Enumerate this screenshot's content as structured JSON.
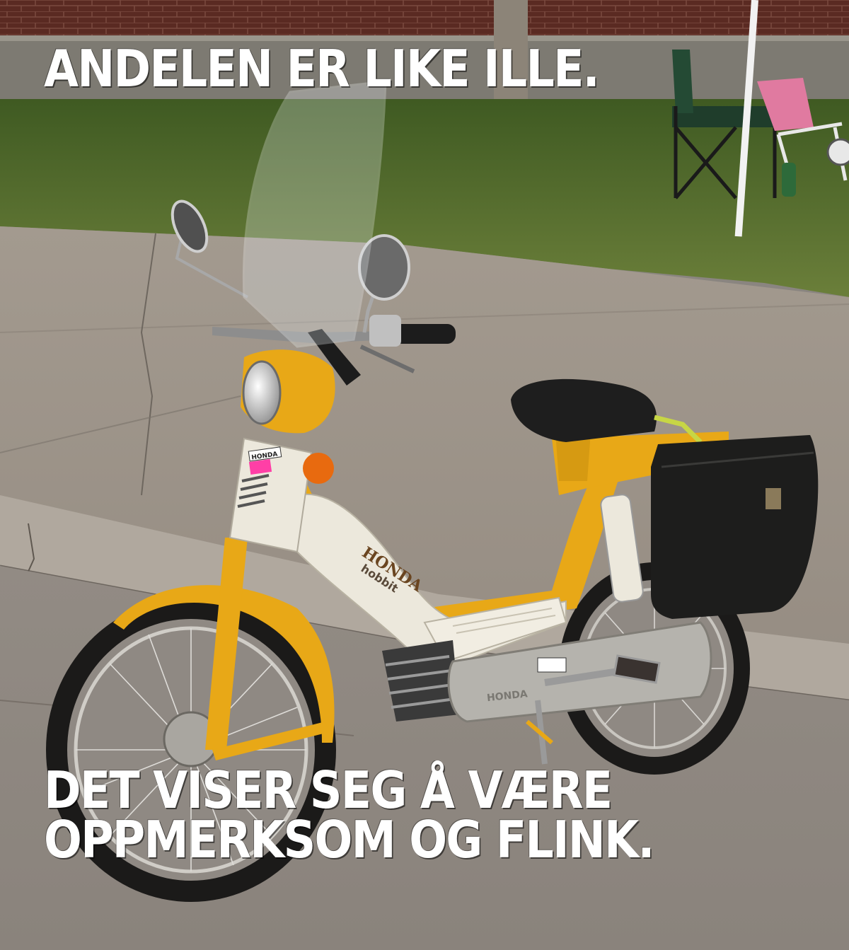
{
  "meme": {
    "top_text": "ANDELEN ER LIKE ILLE.",
    "bottom_lines": [
      "DET VISER SEG Å VÆRE",
      "OPPMERKSOM OG FLINK."
    ]
  },
  "photo": {
    "brand_badge": "HONDA",
    "side_emblem": "HONDA",
    "model_emblem": "hobbit",
    "engine_badge": "HONDA"
  },
  "colors": {
    "moped_yellow": "#e8a817",
    "moped_white": "#ece8dc",
    "asphalt": "#8f8a84",
    "grass": "#4f6b2a",
    "brick": "#5a2a22",
    "caption": "#ffffff"
  }
}
